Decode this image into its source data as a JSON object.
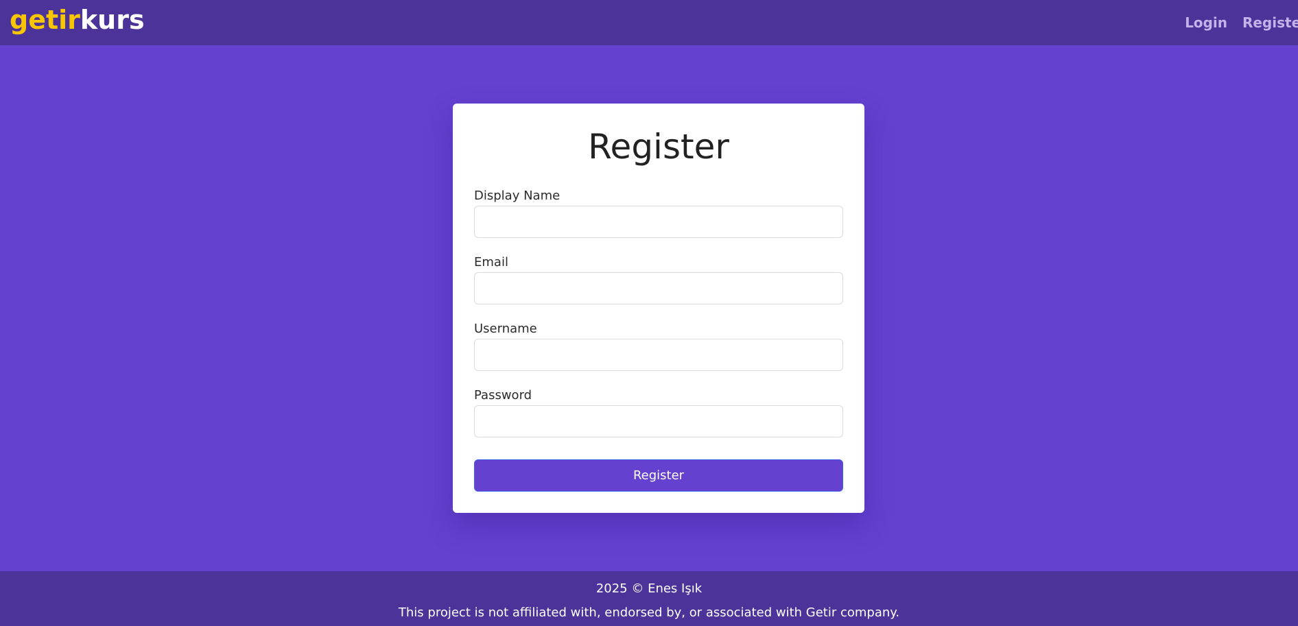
{
  "brand": {
    "part1": "getir",
    "part2": "kurs",
    "color_part1": "#f7c600",
    "color_part2": "#ffffff"
  },
  "nav": {
    "login_label": "Login",
    "register_label": "Register"
  },
  "form": {
    "title": "Register",
    "fields": [
      {
        "label": "Display Name",
        "value": "",
        "placeholder": ""
      },
      {
        "label": "Email",
        "value": "",
        "placeholder": ""
      },
      {
        "label": "Username",
        "value": "",
        "placeholder": ""
      },
      {
        "label": "Password",
        "value": "",
        "placeholder": ""
      }
    ],
    "submit_label": "Register"
  },
  "footer": {
    "copyright": "2025 © Enes Işık",
    "disclaimer": "This project is not affiliated with, endorsed by, or associated with Getir company."
  },
  "colors": {
    "background": "#6441cf",
    "navbar": "#4b3399",
    "footer": "#4b3399",
    "nav_link": "#c2b4ea",
    "button": "#6441cf"
  }
}
